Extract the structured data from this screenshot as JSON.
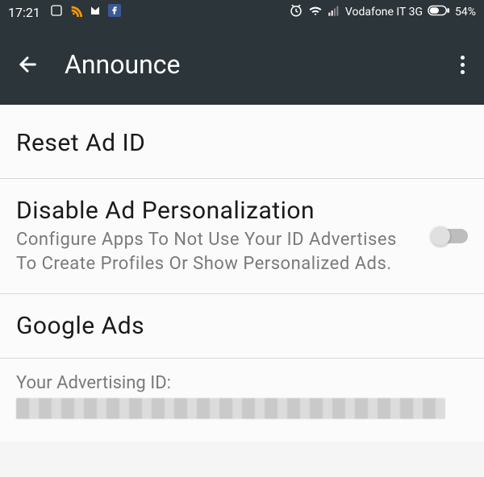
{
  "statusbar": {
    "time": "17:21",
    "carrier": "Vodafone IT 3G",
    "battery_percent": "54%"
  },
  "appbar": {
    "title": "Announce"
  },
  "sections": {
    "reset": {
      "title": "Reset Ad ID"
    },
    "disable": {
      "title": "Disable Ad Personalization",
      "description": "Configure Apps To Not Use Your ID Advertises To Create Profiles Or Show Personalized Ads.",
      "toggle_on": false
    },
    "google_ads": {
      "title": "Google Ads"
    },
    "adid": {
      "label": "Your Advertising ID:",
      "value": ""
    }
  }
}
